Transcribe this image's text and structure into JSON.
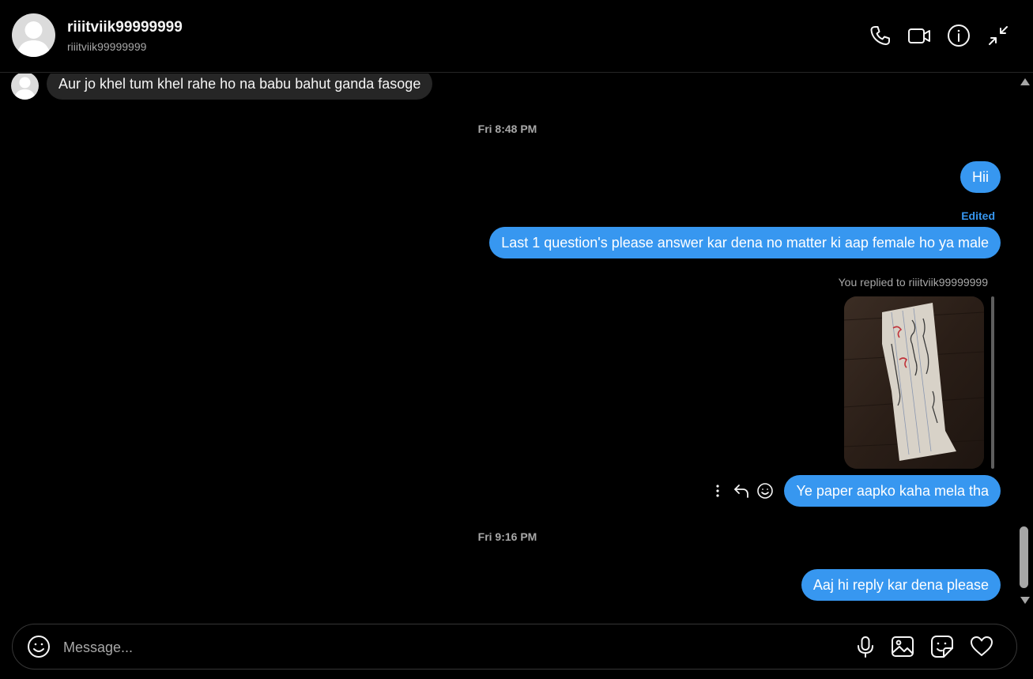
{
  "header": {
    "display_name": "riiitviik99999999",
    "username": "riiitviik99999999",
    "icons": [
      "phone-icon",
      "video-camera-icon",
      "info-icon",
      "collapse-icon"
    ]
  },
  "messages": [
    {
      "direction": "incoming",
      "text": "Aur jo khel tum khel rahe ho na babu bahut ganda fasoge"
    },
    {
      "type": "timestamp",
      "text": "Fri 8:48 PM"
    },
    {
      "direction": "outgoing",
      "text": "Hii"
    },
    {
      "direction": "outgoing",
      "edited_label": "Edited",
      "text": "Last 1 question's please answer kar dena no matter ki aap female ho ya male"
    },
    {
      "direction": "outgoing",
      "reply_label": "You replied to riiitviik99999999",
      "reply_preview": "photo",
      "text": "Ye paper aapko kaha mela tha"
    },
    {
      "type": "timestamp",
      "text": "Fri 9:16 PM"
    },
    {
      "direction": "outgoing",
      "text": "Aaj hi reply kar dena please"
    }
  ],
  "message_actions": [
    "more-options-icon",
    "reply-icon",
    "emoji-react-icon"
  ],
  "composer": {
    "placeholder": "Message...",
    "value": "",
    "icons": [
      "emoji-icon",
      "microphone-icon",
      "image-icon",
      "sticker-icon",
      "heart-icon"
    ]
  },
  "colors": {
    "background": "#000000",
    "outgoing_bubble": "#3797f0",
    "incoming_bubble": "#262626",
    "secondary_text": "#a8a8a8",
    "edited": "#3797f0"
  }
}
